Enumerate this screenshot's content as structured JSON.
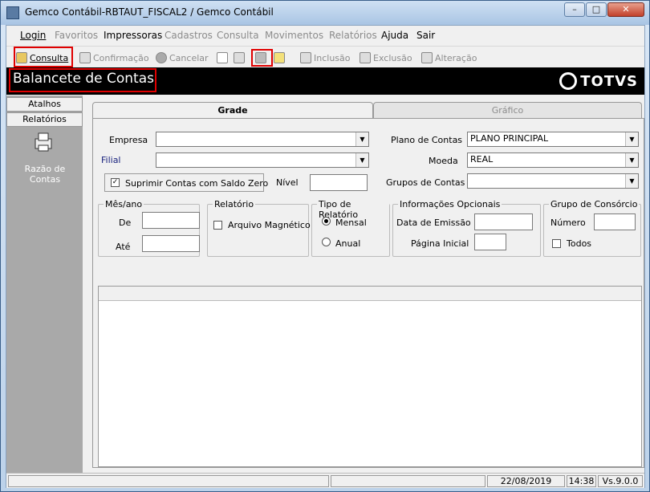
{
  "window": {
    "title": "Gemco Contábil-RBTAUT_FISCAL2 / Gemco Contábil"
  },
  "menu": [
    "Login",
    "Favoritos",
    "Impressoras",
    "Cadastros",
    "Consulta",
    "Movimentos",
    "Relatórios",
    "Ajuda",
    "Sair"
  ],
  "toolbar": {
    "consulta": "Consulta",
    "confirmacao": "Confirmação",
    "cancelar": "Cancelar",
    "inclusao": "Inclusão",
    "exclusao": "Exclusão",
    "alteracao": "Alteração"
  },
  "banner": {
    "title": "Balancete de Contas",
    "brand": "TOTVS"
  },
  "sidebar": {
    "tabs": [
      "Atalhos",
      "Relatórios"
    ],
    "item": "Razão de Contas"
  },
  "tabs": {
    "grade": "Grade",
    "grafico": "Gráfico"
  },
  "form": {
    "empresa": "Empresa",
    "filial": "Filial",
    "plano": "Plano de Contas",
    "plano_value": "PLANO PRINCIPAL",
    "moeda": "Moeda",
    "moeda_value": "REAL",
    "grupos": "Grupos de Contas",
    "suprimir": "Suprimir Contas com Saldo Zero",
    "nivel": "Nível",
    "mesano": "Mês/ano",
    "de": "De",
    "ate": "Até",
    "relatorio": "Relatório",
    "arquivo": "Arquivo Magnético",
    "tipo": "Tipo de Relatório",
    "mensal": "Mensal",
    "anual": "Anual",
    "info": "Informações Opcionais",
    "data_emissao": "Data de Emissão",
    "pagina": "Página Inicial",
    "consorcio": "Grupo de Consórcio",
    "numero": "Número",
    "todos": "Todos"
  },
  "status": {
    "date": "22/08/2019",
    "time": "14:38",
    "version": "Vs.9.0.0"
  }
}
